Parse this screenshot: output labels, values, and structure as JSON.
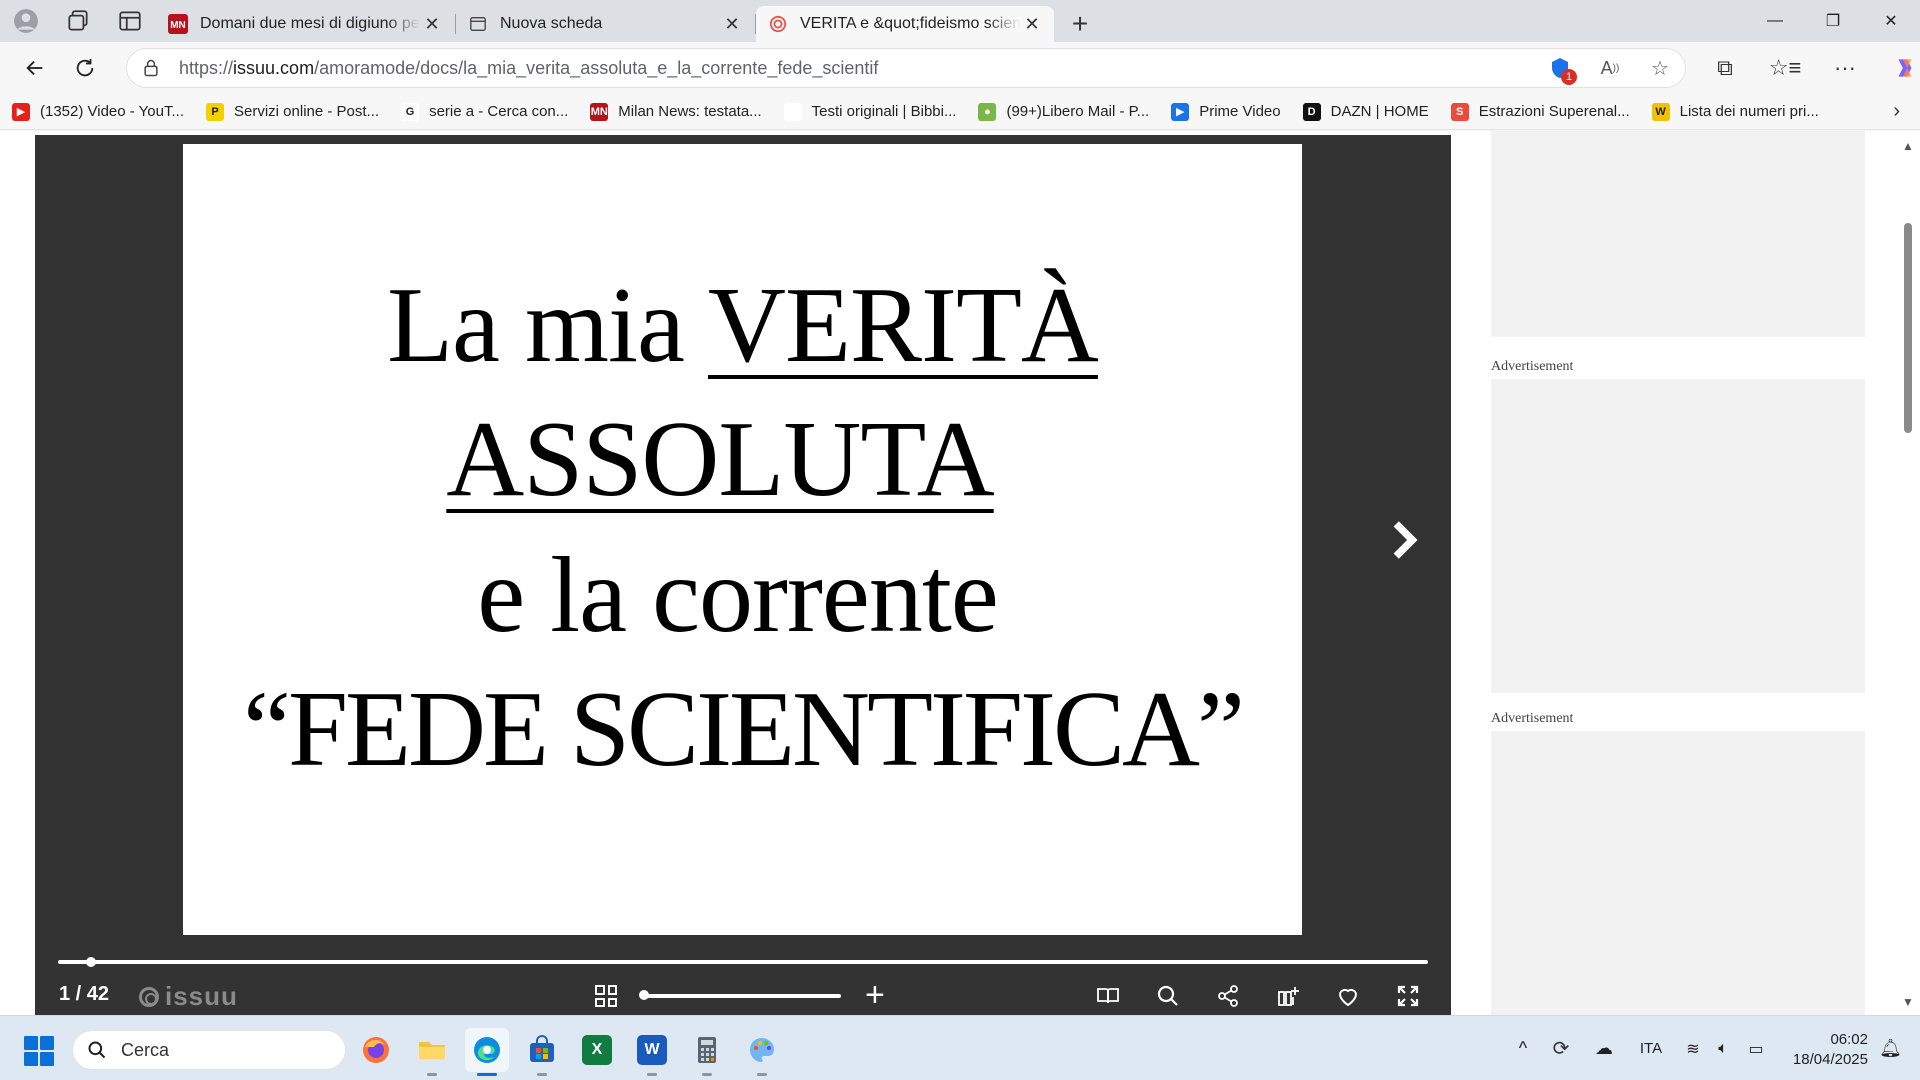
{
  "tabs": [
    {
      "title": "Domani due mesi di digiuno per C",
      "favicon": "milan-news-icon",
      "active": false
    },
    {
      "title": "Nuova scheda",
      "favicon": "new-tab-page-icon",
      "active": false
    },
    {
      "title": "VERITA e &quot;fideismo scientifi",
      "favicon": "issuu-icon",
      "active": true
    }
  ],
  "address": {
    "url_prefix": "https://",
    "url_domain": "issuu.com",
    "url_path": "/amoramode/docs/la_mia_verita_assoluta_e_la_corrente_fede_scientif",
    "notification_count": "1"
  },
  "bookmarks": [
    {
      "label": "(1352) Video - YouT...",
      "icon": "youtube-icon",
      "color": "#e62117",
      "glyph": "▶"
    },
    {
      "label": "Servizi online - Post...",
      "icon": "poste-icon",
      "color": "#f5d000",
      "glyph": "P"
    },
    {
      "label": "serie a - Cerca con...",
      "icon": "google-icon",
      "color": "#ffffff",
      "glyph": "G"
    },
    {
      "label": "Milan News: testata...",
      "icon": "milan-news-icon",
      "color": "#b5121b",
      "glyph": "MN"
    },
    {
      "label": "Testi originali | Bibbi...",
      "icon": "blank-page-icon",
      "color": "#ffffff",
      "glyph": ""
    },
    {
      "label": "(99+)Libero Mail - P...",
      "icon": "libero-icon",
      "color": "#7ab648",
      "glyph": "●"
    },
    {
      "label": "Prime Video",
      "icon": "prime-video-icon",
      "color": "#1a73e8",
      "glyph": "▶"
    },
    {
      "label": "DAZN | HOME",
      "icon": "dazn-icon",
      "color": "#111111",
      "glyph": "D"
    },
    {
      "label": "Estrazioni Superenal...",
      "icon": "superenalotto-icon",
      "color": "#e94b3c",
      "glyph": "S"
    },
    {
      "label": "Lista dei numeri pri...",
      "icon": "list-icon",
      "color": "#f2c200",
      "glyph": "W"
    }
  ],
  "document": {
    "line1_plain": "La mia ",
    "line1_underlined": "VERITÀ ",
    "line2_underlined": "ASSOLUTA",
    "line3": "e la corrente",
    "line4": "“FEDE SCIENTIFICA”"
  },
  "reader": {
    "page_indicator": "1 / 42",
    "brand": "issuu",
    "page_progress": 0.024,
    "zoom_level": 0.0
  },
  "ads": {
    "label": "Advertisement"
  },
  "taskbar": {
    "search_placeholder": "Cerca",
    "language": "ITA",
    "time": "06:02",
    "date": "18/04/2025"
  },
  "colors": {
    "reader_bg": "#333333",
    "accent": "#0a6fd6"
  }
}
